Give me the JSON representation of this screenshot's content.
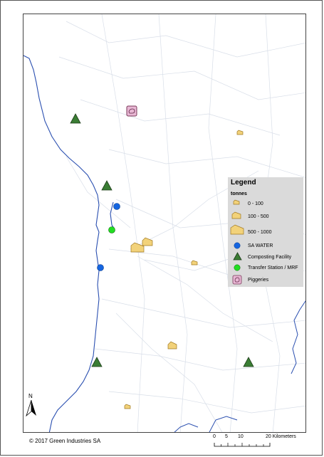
{
  "legend": {
    "title": "Legend",
    "subtitle": "tonnes",
    "items": [
      {
        "label": "0 - 100"
      },
      {
        "label": "100 - 500"
      },
      {
        "label": "500 - 1000"
      },
      {
        "label": "SA WATER"
      },
      {
        "label": "Composting Facility"
      },
      {
        "label": "Transfer Station / MRF"
      },
      {
        "label": "Piggeries"
      }
    ]
  },
  "copyright": "© 2017 Green Industries SA",
  "north_label": "N",
  "scale": {
    "ticks": [
      "0",
      "5",
      "10",
      "20 Kilometers"
    ]
  },
  "colors": {
    "sa_water": "#1565e0",
    "composting": "#3a7d34",
    "transfer": "#22dd22",
    "piggeries": "#e8b7d4",
    "cheese": "#f2d27a",
    "coast": "#2a4fb0"
  }
}
